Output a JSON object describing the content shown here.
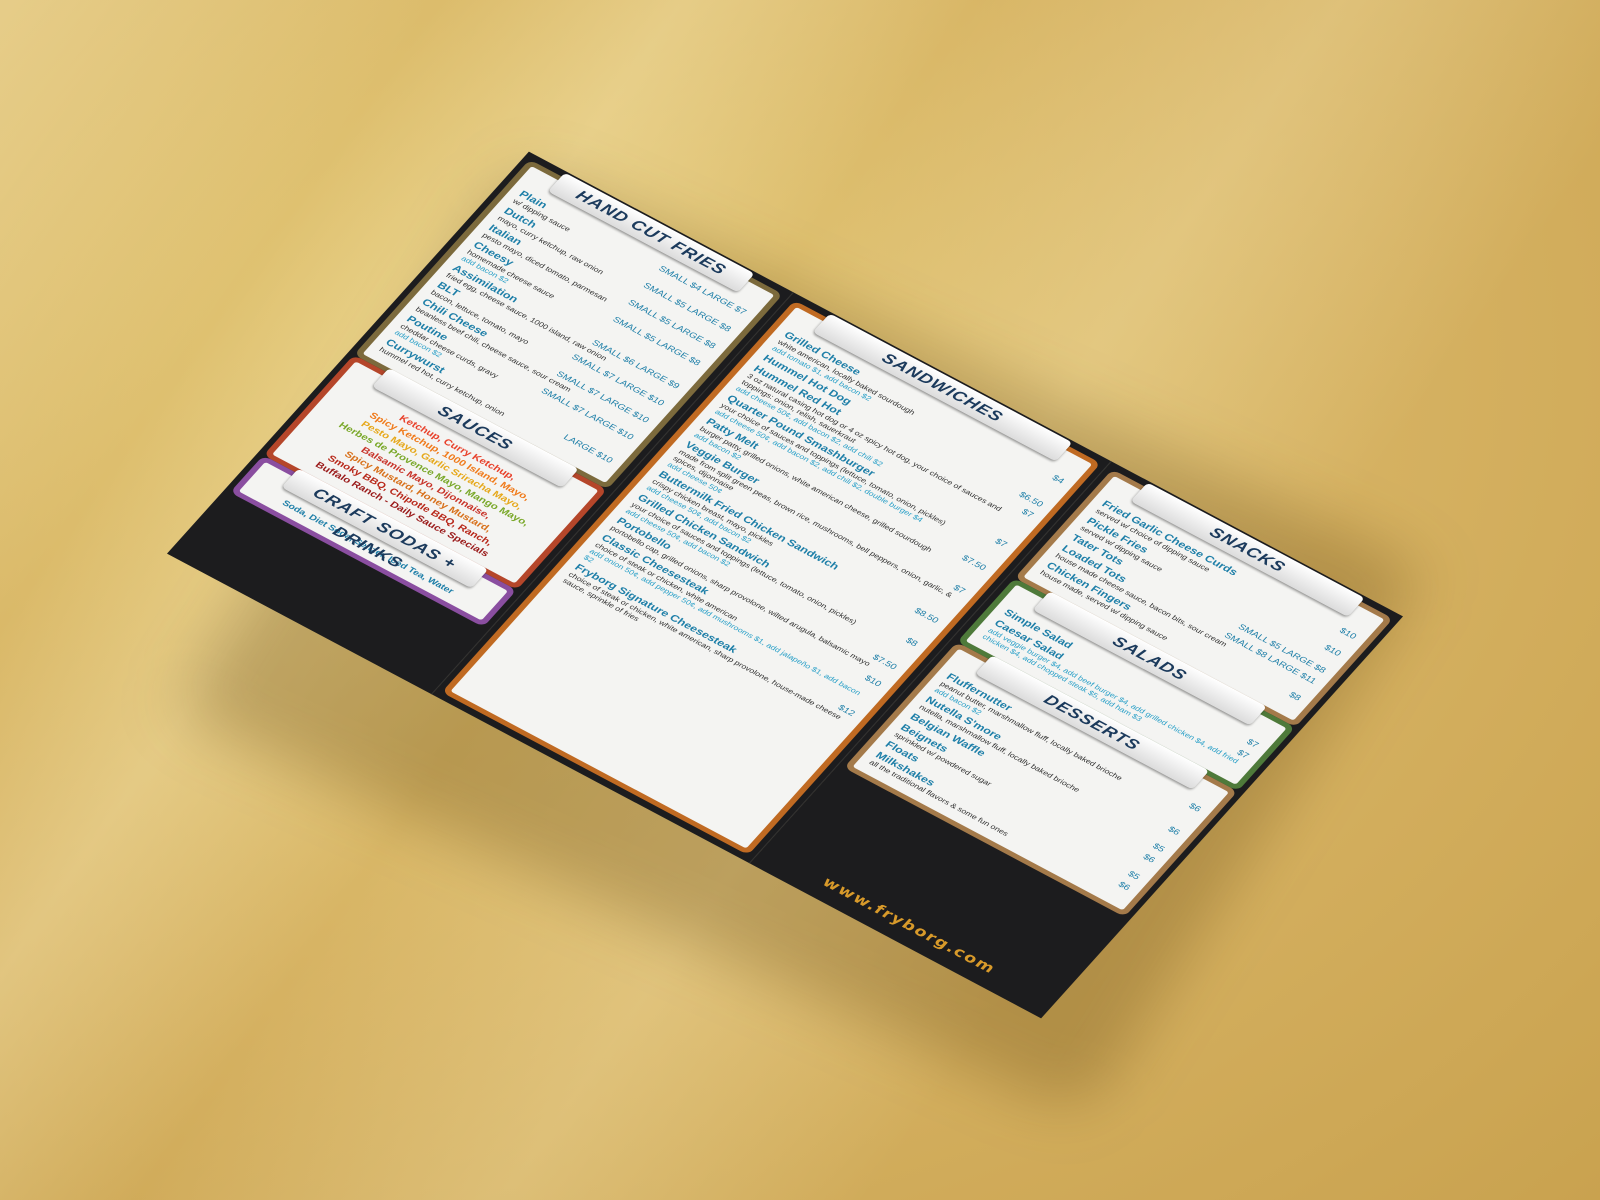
{
  "colors": {
    "background": "#d6b262",
    "brochure": "#1c1c1e",
    "item_name": "#1e7fa8",
    "website": "#d89a2a"
  },
  "fries": {
    "title": "HAND CUT FRIES",
    "items": [
      {
        "name": "Plain",
        "desc": "w/ dipping sauce",
        "price": "SMALL $4",
        "price2": "LARGE $7",
        "addon": ""
      },
      {
        "name": "Dutch",
        "desc": "mayo, curry ketchup, raw onion",
        "price": "SMALL $5",
        "price2": "LARGE $8",
        "addon": ""
      },
      {
        "name": "Italian",
        "desc": "pesto mayo, diced tomato, parmesan",
        "price": "SMALL $5",
        "price2": "LARGE $8",
        "addon": ""
      },
      {
        "name": "Cheesy",
        "desc": "homemade cheese sauce",
        "price": "SMALL $5",
        "price2": "LARGE $8",
        "addon": "add bacon $2"
      },
      {
        "name": "Assimilation",
        "desc": "fried egg, cheese sauce, 1000 island, raw onion",
        "price": "SMALL $6",
        "price2": "LARGE $9",
        "addon": ""
      },
      {
        "name": "BLT",
        "desc": "bacon, lettuce, tomato, mayo",
        "price": "SMALL $7",
        "price2": "LARGE $10",
        "addon": ""
      },
      {
        "name": "Chili Cheese",
        "desc": "beanless beef chili, cheese sauce, sour cream",
        "price": "SMALL $7",
        "price2": "LARGE $10",
        "addon": ""
      },
      {
        "name": "Poutine",
        "desc": "cheddar cheese curds, gravy",
        "price": "SMALL $7",
        "price2": "LARGE $10",
        "addon": "add bacon $2"
      },
      {
        "name": "Currywurst",
        "desc": "hummel red hot, curry ketchup, onion",
        "price": "",
        "price2": "LARGE $10",
        "addon": ""
      }
    ]
  },
  "sauces": {
    "title": "SAUCES",
    "lines": [
      {
        "text": "Ketchup, Curry Ketchup,",
        "color": "#e8402a"
      },
      {
        "text": "Spicy Ketchup, 1000 Island, Mayo,",
        "color": "#f07a1a"
      },
      {
        "text": "Pesto Mayo, Garlic Sriracha Mayo,",
        "color": "#e6a81a"
      },
      {
        "text": "Herbes de Provence Mayo, Mango Mayo,",
        "color": "#7aa82a"
      },
      {
        "text": "Balsamic Mayo, Dijonnaise,",
        "color": "#c8342a"
      },
      {
        "text": "Spicy Mustard, Honey Mustard,",
        "color": "#d8701a"
      },
      {
        "text": "Smoky BBQ, Chipotle BBQ, Ranch,",
        "color": "#b8281a"
      },
      {
        "text": "Buffalo Ranch - Daily Sauce Specials",
        "color": "#9a1a1a"
      }
    ]
  },
  "drinks": {
    "title": "CRAFT SODAS + DRINKS",
    "text": "Soda, Diet Soda, Seltzer, Iced Tea, Water"
  },
  "sandwiches": {
    "title": "SANDWICHES",
    "items": [
      {
        "name": "Grilled Cheese",
        "desc": "white american, locally baked sourdough",
        "addon": "add tomato $1, add bacon $2",
        "price": "$4"
      },
      {
        "name": "Hummel Hot Dog",
        "desc": "",
        "addon": "",
        "price": "$6.50"
      },
      {
        "name": "Hummel Red Hot",
        "desc": "3 oz natural casing hot dog or 4 oz spicy hot dog, your choice of sauces and toppings: onion, relish, sauerkraut",
        "addon": "add cheese 50¢, add bacon $2, add chili $2",
        "price": "$7"
      },
      {
        "name": "Quarter Pound Smashburger",
        "desc": "your choice of sauces and toppings (lettuce, tomato, onion, pickles)",
        "addon": "add cheese 50¢, add bacon $2, add chili $2, double burger $4",
        "price": "$7"
      },
      {
        "name": "Patty Melt",
        "desc": "burger patty, grilled onions, white american cheese, grilled sourdough",
        "addon": "add bacon $2",
        "price": "$7.50"
      },
      {
        "name": "Veggie Burger",
        "desc": "made from split green peas, brown rice, mushrooms, bell peppers, onion, garlic, & spices, dijonnaise",
        "addon": "add cheese 50¢",
        "price": "$7"
      },
      {
        "name": "Buttermilk Fried Chicken Sandwich",
        "desc": "crispy chicken breast, mayo, pickles",
        "addon": "add cheese 50¢, add bacon $2",
        "price": "$8.50"
      },
      {
        "name": "Grilled Chicken Sandwich",
        "desc": "your choice of sauces and toppings (lettuce, tomato, onion, pickles)",
        "addon": "add cheese 50¢, add bacon $2",
        "price": "$8"
      },
      {
        "name": "Portobello",
        "desc": "portobello cap, grilled onions, sharp provolone, wilted arugula, balsamic mayo",
        "addon": "",
        "price": "$7.50"
      },
      {
        "name": "Classic Cheesesteak",
        "desc": "choice of steak or chicken, white american",
        "addon": "add onion 50¢, add pepper 50¢, add mushrooms $1, add jalapeño $1, add bacon $2",
        "price": "$10"
      },
      {
        "name": "Fryborg Signature Cheesesteak",
        "desc": "choice of steak or chicken, white american, sharp provolone, house-made cheese sauce, sprinkle of fries",
        "addon": "",
        "price": "$12"
      }
    ]
  },
  "snacks": {
    "title": "SNACKS",
    "items": [
      {
        "name": "Fried Garlic Cheese Curds",
        "desc": "served w/ choice of dipping sauce",
        "price": "$10",
        "price2": ""
      },
      {
        "name": "Pickle Fries",
        "desc": "served w/ dipping sauce",
        "price": "$10",
        "price2": ""
      },
      {
        "name": "Tater Tots",
        "desc": "",
        "price": "SMALL $5",
        "price2": "LARGE $8"
      },
      {
        "name": "Loaded Tots",
        "desc": "house made cheese sauce, bacon bits, sour cream",
        "price": "SMALL $8",
        "price2": "LARGE $11"
      },
      {
        "name": "Chicken Fingers",
        "desc": "house made, served w/ dipping sauce",
        "price": "$8",
        "price2": ""
      }
    ]
  },
  "salads": {
    "title": "SALADS",
    "items": [
      {
        "name": "Simple Salad",
        "desc": "",
        "addon": "",
        "price": "$7"
      },
      {
        "name": "Caesar Salad",
        "desc": "",
        "addon": "add veggie burger $4, add beef burger $4, add grilled chicken $4, add fried chicken $4, add chopped steak $5, add ham $3",
        "price": "$7"
      }
    ]
  },
  "desserts": {
    "title": "DESSERTS",
    "items": [
      {
        "name": "Fluffernutter",
        "desc": "peanut butter, marshmallow fluff, locally baked brioche",
        "addon": "add bacon $2",
        "price": "$6"
      },
      {
        "name": "Nutella S'more",
        "desc": "nutella, marshmallow fluff, locally baked brioche",
        "addon": "",
        "price": "$6"
      },
      {
        "name": "Belgian Waffle",
        "desc": "",
        "addon": "",
        "price": "$5"
      },
      {
        "name": "Beignets",
        "desc": "sprinkled w/ powdered sugar",
        "addon": "",
        "price": "$6"
      },
      {
        "name": "Floats",
        "desc": "",
        "addon": "",
        "price": "$5"
      },
      {
        "name": "Milkshakes",
        "desc": "all the traditional flavors & some fun ones",
        "addon": "",
        "price": "$6"
      }
    ]
  },
  "website": "www.fryborg.com"
}
